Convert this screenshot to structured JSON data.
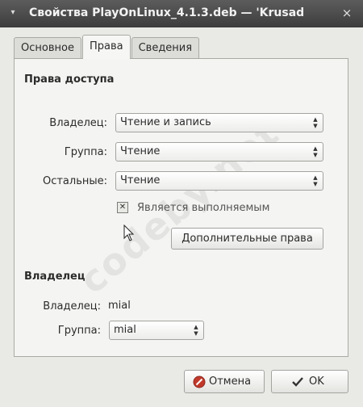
{
  "window": {
    "title": "Свойства PlayOnLinux_4.1.3.deb — 'Krusad",
    "close_glyph": "×",
    "menu_glyph": "▾"
  },
  "tabs": [
    {
      "label": "Основное",
      "active": false
    },
    {
      "label": "Права",
      "active": true
    },
    {
      "label": "Сведения",
      "active": false
    }
  ],
  "access": {
    "heading": "Права доступа",
    "owner_label": "Владелец:",
    "owner_value": "Чтение и запись",
    "group_label": "Группа:",
    "group_value": "Чтение",
    "others_label": "Остальные:",
    "others_value": "Чтение",
    "executable_label": "Является выполняемым",
    "executable_checked": true,
    "advanced_button": "Дополнительные права"
  },
  "ownership": {
    "heading": "Владелец",
    "owner_label": "Владелец:",
    "owner_value": "mial",
    "group_label": "Группа:",
    "group_value": "mial"
  },
  "watermark": "codeby.net",
  "footer": {
    "cancel_label": "Отмена",
    "ok_label": "OK"
  },
  "colors": {
    "titlebar": "#3d3d3d",
    "panel": "#f4f4f2",
    "cancel_icon": "#c0392b"
  },
  "icons": {
    "cancel": "cancel-icon",
    "ok": "checkmark-icon",
    "close": "close-icon",
    "menu": "window-menu-icon"
  }
}
